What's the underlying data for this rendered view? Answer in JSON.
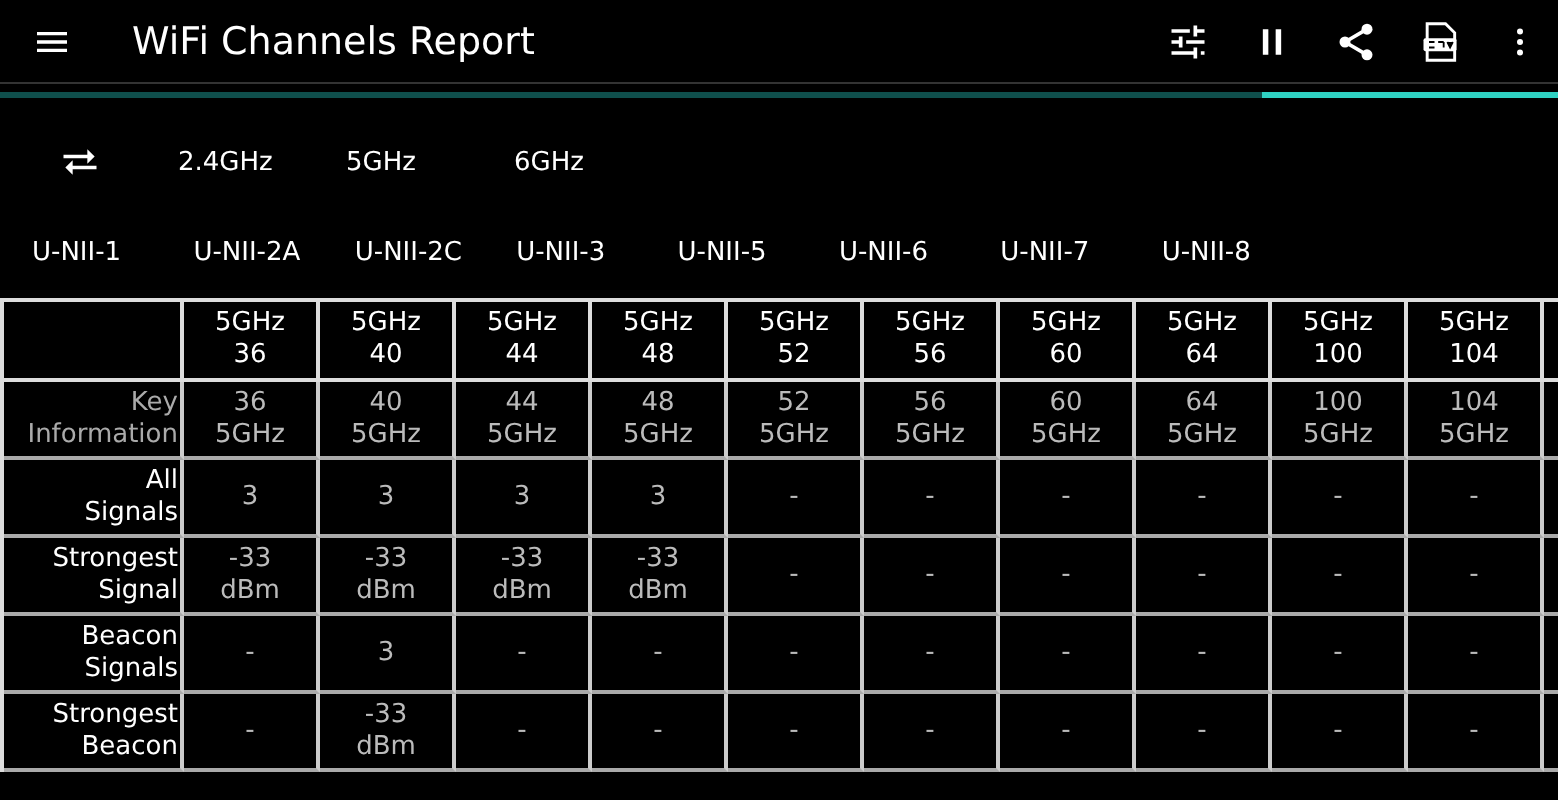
{
  "app_bar": {
    "title": "WiFi Channels Report"
  },
  "progress": {
    "level": 0.19
  },
  "bands": [
    "2.4GHz",
    "5GHz",
    "6GHz"
  ],
  "sub_bands": [
    "U-NII-1",
    "U-NII-2A",
    "U-NII-2C",
    "U-NII-3",
    "U-NII-5",
    "U-NII-6",
    "U-NII-7",
    "U-NII-8"
  ],
  "table": {
    "columns": [
      "5GHz\n36",
      "5GHz\n40",
      "5GHz\n44",
      "5GHz\n48",
      "5GHz\n52",
      "5GHz\n56",
      "5GHz\n60",
      "5GHz\n64",
      "5GHz\n100",
      "5GHz\n104"
    ],
    "rows": [
      {
        "kind": "key",
        "label": "Key\nInformation",
        "cells": [
          "36\n5GHz",
          "40\n5GHz",
          "44\n5GHz",
          "48\n5GHz",
          "52\n5GHz",
          "56\n5GHz",
          "60\n5GHz",
          "64\n5GHz",
          "100\n5GHz",
          "104\n5GHz"
        ]
      },
      {
        "kind": "metric",
        "label": "All\nSignals",
        "cells": [
          "3",
          "3",
          "3",
          "3",
          "-",
          "-",
          "-",
          "-",
          "-",
          "-"
        ]
      },
      {
        "kind": "metric",
        "label": "Strongest\nSignal",
        "cells": [
          "-33\ndBm",
          "-33\ndBm",
          "-33\ndBm",
          "-33\ndBm",
          "-",
          "-",
          "-",
          "-",
          "-",
          "-"
        ]
      },
      {
        "kind": "metric",
        "label": "Beacon\nSignals",
        "cells": [
          "-",
          "3",
          "-",
          "-",
          "-",
          "-",
          "-",
          "-",
          "-",
          "-"
        ]
      },
      {
        "kind": "metric",
        "label": "Strongest\nBeacon",
        "cells": [
          "-",
          "-33\ndBm",
          "-",
          "-",
          "-",
          "-",
          "-",
          "-",
          "-",
          "-"
        ]
      }
    ]
  }
}
